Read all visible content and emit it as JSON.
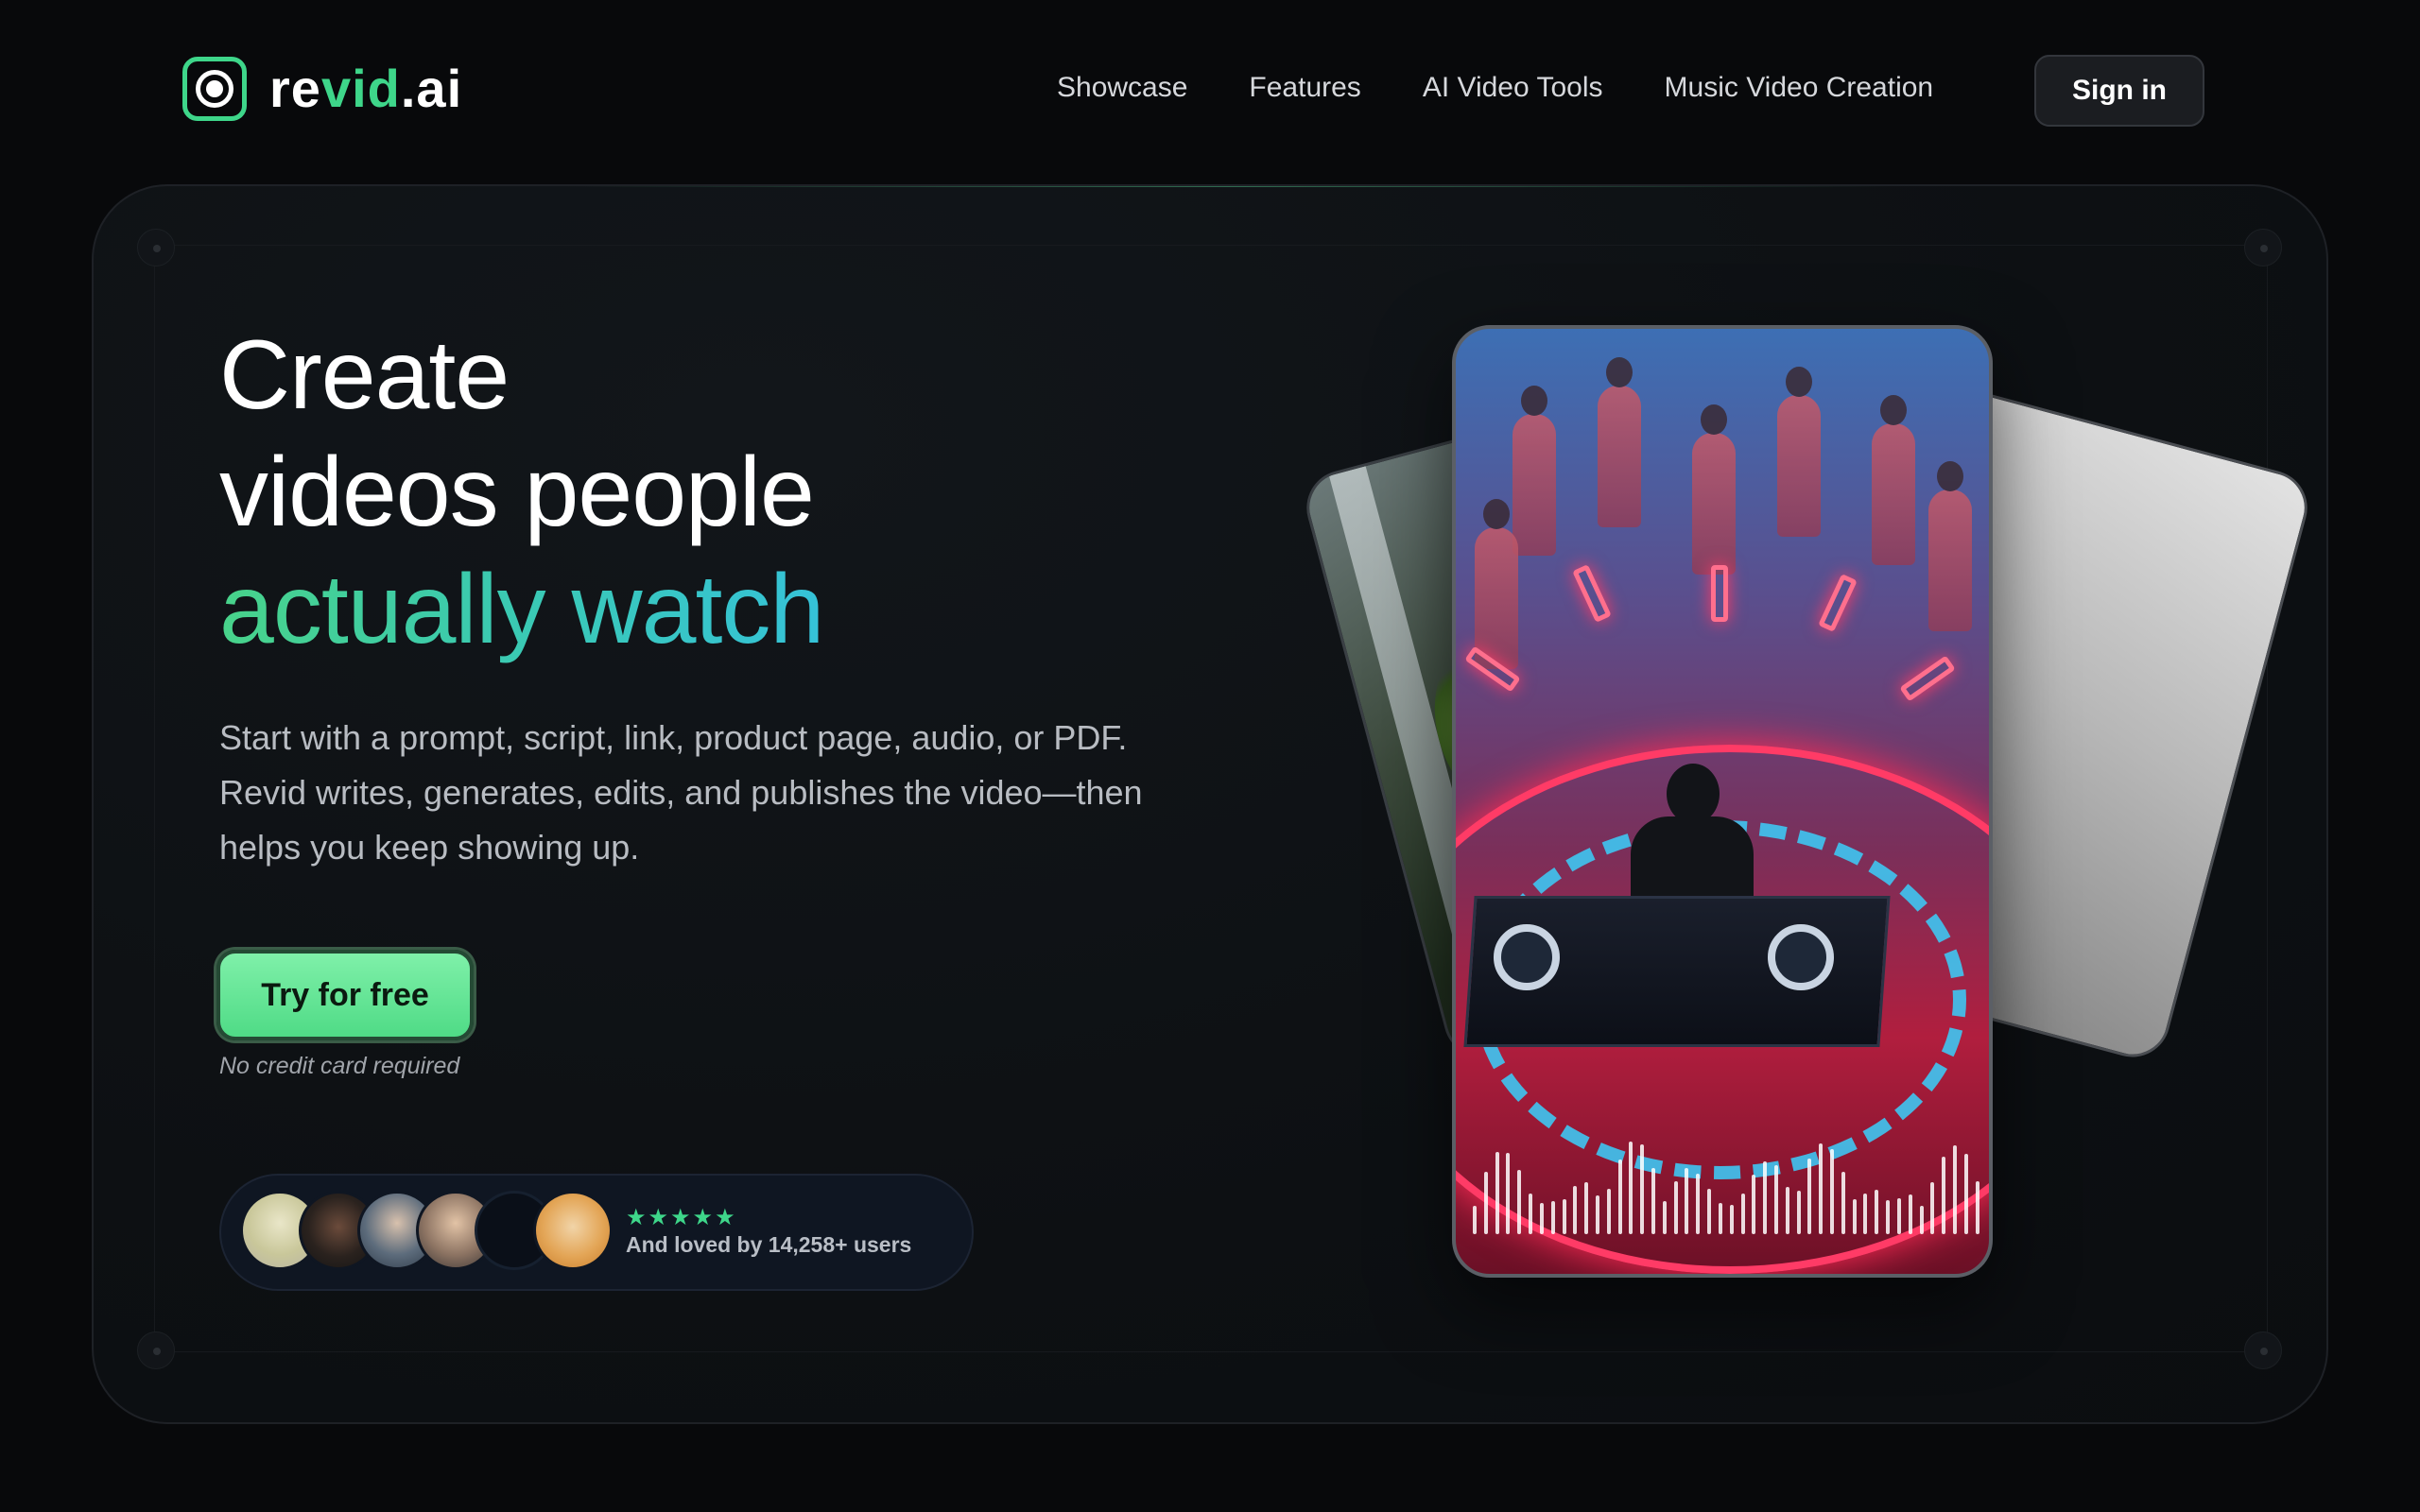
{
  "brand": {
    "name_prefix": "re",
    "name_accent": "vid",
    "name_suffix": ".ai"
  },
  "nav": {
    "links": [
      "Showcase",
      "Features",
      "AI Video Tools",
      "Music Video Creation"
    ],
    "sign_in": "Sign in"
  },
  "hero": {
    "headline_line1": "Create",
    "headline_line2": "videos people",
    "headline_line3a": "actually",
    "headline_line3b": "watch",
    "subtext": "Start with a prompt, script, link, product page, audio, or PDF. Revid writes, generates, edits, and publishes the video—then helps you keep showing up.",
    "cta": "Try for free",
    "cta_note": "No credit card required"
  },
  "social_proof": {
    "stars": "★★★★★",
    "rating": 5,
    "loved_text": "And loved by 14,258+ users"
  },
  "colors": {
    "accent_green": "#3ed68a",
    "headline_gradient_start": "#48d38a",
    "headline_gradient_end": "#35c2d8",
    "background": "#08090b"
  }
}
